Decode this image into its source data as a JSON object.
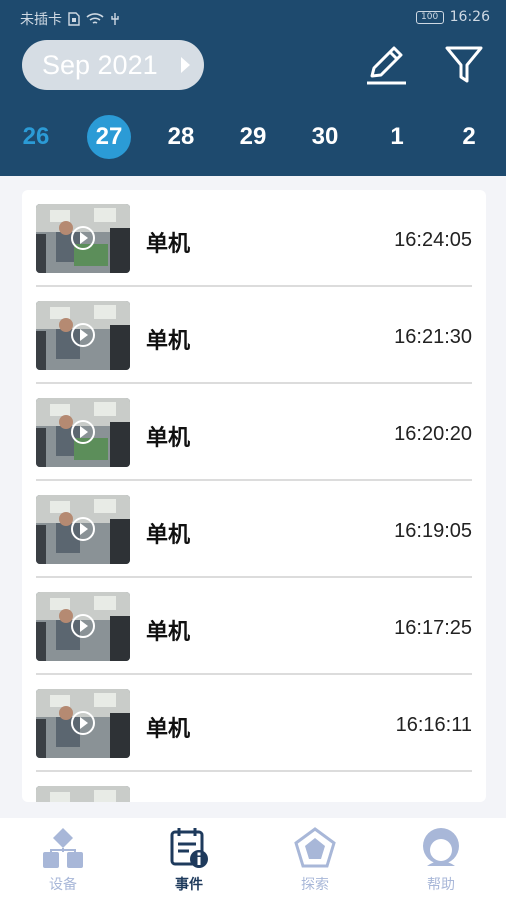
{
  "status_bar": {
    "carrier": "未插卡",
    "battery": "100",
    "time": "16:26"
  },
  "header": {
    "month": "Sep 2021",
    "edit_icon": "edit-pen-icon",
    "filter_icon": "filter-funnel-icon"
  },
  "days": [
    {
      "label": "26"
    },
    {
      "label": "27"
    },
    {
      "label": "28"
    },
    {
      "label": "29"
    },
    {
      "label": "30"
    },
    {
      "label": "1"
    },
    {
      "label": "2"
    }
  ],
  "selected_day": "27",
  "events": [
    {
      "title": "单机",
      "time": "16:24:05"
    },
    {
      "title": "单机",
      "time": "16:21:30"
    },
    {
      "title": "单机",
      "time": "16:20:20"
    },
    {
      "title": "单机",
      "time": "16:19:05"
    },
    {
      "title": "单机",
      "time": "16:17:25"
    },
    {
      "title": "单机",
      "time": "16:16:11"
    }
  ],
  "tabs": [
    {
      "label": "设备",
      "icon": "device-icon"
    },
    {
      "label": "事件",
      "icon": "event-calendar-icon"
    },
    {
      "label": "探索",
      "icon": "explore-pentagon-icon"
    },
    {
      "label": "帮助",
      "icon": "help-person-icon"
    }
  ],
  "colors": {
    "header_bg": "#1e4a6e",
    "accent": "#2b9bd6",
    "tab_inactive": "#a8b7d8",
    "tab_active": "#1e3a5c"
  }
}
